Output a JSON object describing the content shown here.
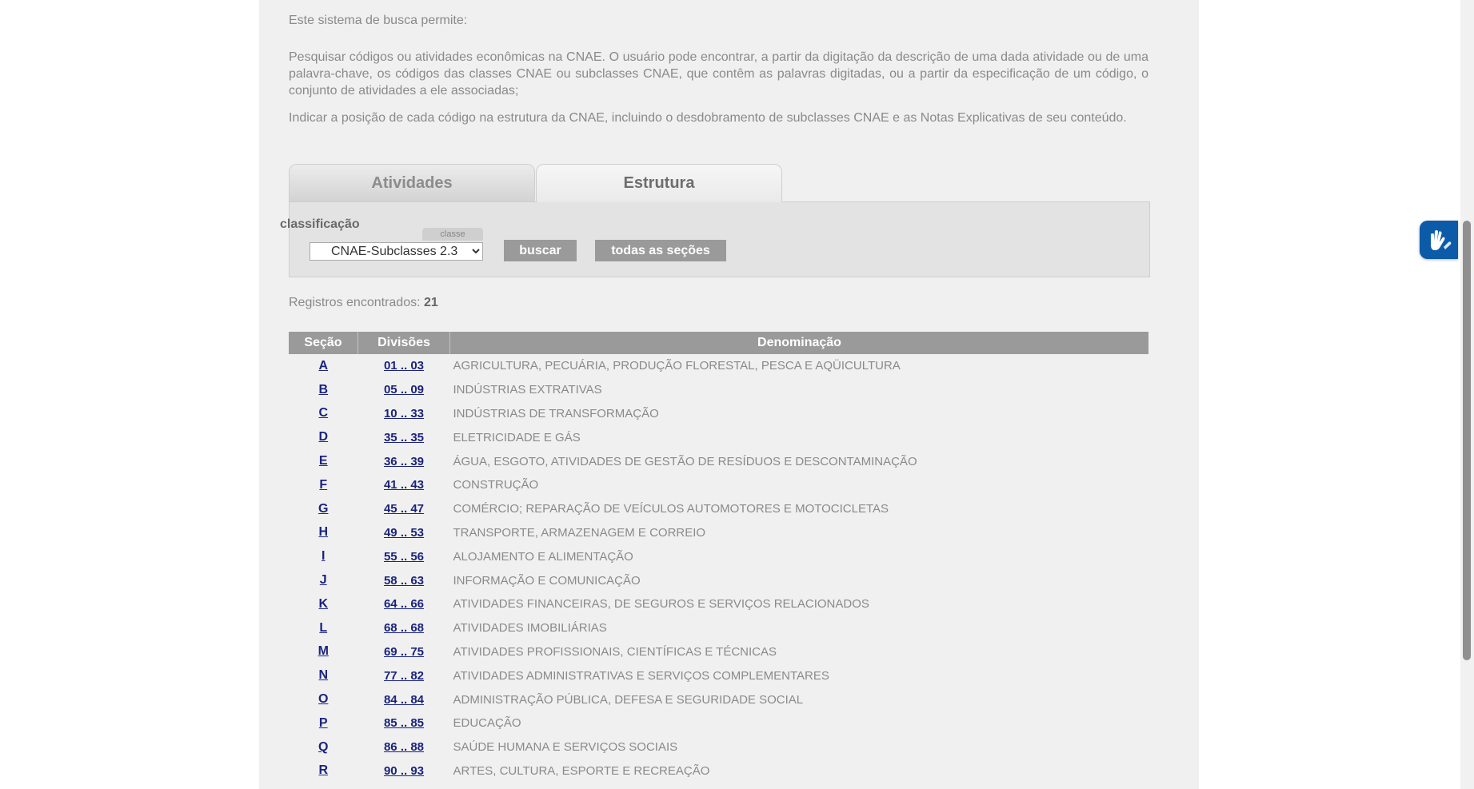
{
  "intro": {
    "heading": "Este sistema de busca permite:",
    "para1": "Pesquisar códigos ou atividades econômicas na CNAE. O usuário pode encontrar, a partir da digitação da descrição de uma dada atividade ou de uma palavra-chave, os códigos das classes CNAE ou subclasses CNAE, que contêm as palavras digitadas, ou a partir da especificação de um código, o conjunto de atividades a ele associadas;",
    "para2": "Indicar a posição de cada código na estrutura da CNAE, incluindo o desdobramento de subclasses CNAE e as Notas Explicativas de seu conteúdo."
  },
  "tabs": {
    "atividades": "Atividades",
    "estrutura": "Estrutura"
  },
  "search": {
    "label": "classificação",
    "badge": "classe",
    "selected": "CNAE-Subclasses 2.3",
    "buscar": "buscar",
    "todas": "todas as seções"
  },
  "results": {
    "label": "Registros encontrados:",
    "count": "21"
  },
  "table": {
    "headers": {
      "secao": "Seção",
      "divisoes": "Divisões",
      "denominacao": "Denominação"
    },
    "rows": [
      {
        "secao": "A",
        "divisoes": "01 .. 03",
        "denominacao": "AGRICULTURA, PECUÁRIA, PRODUÇÃO FLORESTAL, PESCA E AQÜICULTURA"
      },
      {
        "secao": "B",
        "divisoes": "05 .. 09",
        "denominacao": "INDÚSTRIAS EXTRATIVAS"
      },
      {
        "secao": "C",
        "divisoes": "10 .. 33",
        "denominacao": "INDÚSTRIAS DE TRANSFORMAÇÃO"
      },
      {
        "secao": "D",
        "divisoes": "35 .. 35",
        "denominacao": "ELETRICIDADE E GÁS"
      },
      {
        "secao": "E",
        "divisoes": "36 .. 39",
        "denominacao": "ÁGUA, ESGOTO, ATIVIDADES DE GESTÃO DE RESÍDUOS E DESCONTAMINAÇÃO"
      },
      {
        "secao": "F",
        "divisoes": "41 .. 43",
        "denominacao": "CONSTRUÇÃO"
      },
      {
        "secao": "G",
        "divisoes": "45 .. 47",
        "denominacao": "COMÉRCIO; REPARAÇÃO DE VEÍCULOS AUTOMOTORES E MOTOCICLETAS"
      },
      {
        "secao": "H",
        "divisoes": "49 .. 53",
        "denominacao": "TRANSPORTE, ARMAZENAGEM E CORREIO"
      },
      {
        "secao": "I",
        "divisoes": "55 .. 56",
        "denominacao": "ALOJAMENTO E ALIMENTAÇÃO"
      },
      {
        "secao": "J",
        "divisoes": "58 .. 63",
        "denominacao": "INFORMAÇÃO E COMUNICAÇÃO"
      },
      {
        "secao": "K",
        "divisoes": "64 .. 66",
        "denominacao": "ATIVIDADES FINANCEIRAS, DE SEGUROS E SERVIÇOS RELACIONADOS"
      },
      {
        "secao": "L",
        "divisoes": "68 .. 68",
        "denominacao": "ATIVIDADES IMOBILIÁRIAS"
      },
      {
        "secao": "M",
        "divisoes": "69 .. 75",
        "denominacao": "ATIVIDADES PROFISSIONAIS, CIENTÍFICAS E TÉCNICAS"
      },
      {
        "secao": "N",
        "divisoes": "77 .. 82",
        "denominacao": "ATIVIDADES ADMINISTRATIVAS E SERVIÇOS COMPLEMENTARES"
      },
      {
        "secao": "O",
        "divisoes": "84 .. 84",
        "denominacao": "ADMINISTRAÇÃO PÚBLICA, DEFESA E SEGURIDADE SOCIAL"
      },
      {
        "secao": "P",
        "divisoes": "85 .. 85",
        "denominacao": "EDUCAÇÃO"
      },
      {
        "secao": "Q",
        "divisoes": "86 .. 88",
        "denominacao": "SAÚDE HUMANA E SERVIÇOS SOCIAIS"
      },
      {
        "secao": "R",
        "divisoes": "90 .. 93",
        "denominacao": "ARTES, CULTURA, ESPORTE E RECREAÇÃO"
      }
    ]
  },
  "widgets": {
    "vlibras_icon": "hands-sign-language-icon"
  },
  "colors": {
    "header_bg": "#9a9a9a",
    "link": "#1a237e",
    "panel_bg": "#f0f0f0",
    "vlibras": "#0b5ba8"
  }
}
